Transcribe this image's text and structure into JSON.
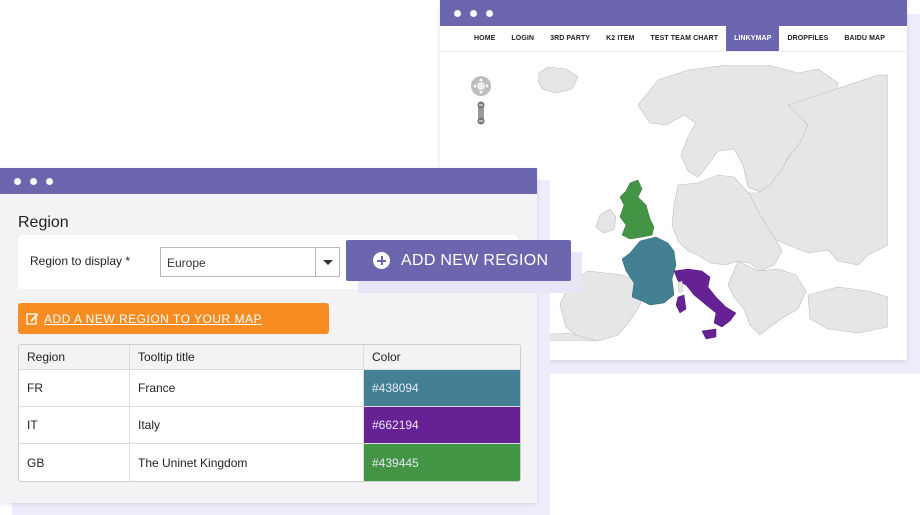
{
  "map_window": {
    "nav": [
      "HOME",
      "LOGIN",
      "3RD PARTY",
      "K2 ITEM",
      "TEST TEAM CHART",
      "LINKYMAP",
      "DROPFILES",
      "BAIDU MAP"
    ],
    "active_nav": "LINKYMAP",
    "colors": {
      "france": "#438094",
      "italy": "#662194",
      "gb": "#439445",
      "land": "#e6e6e6"
    },
    "icons": [
      "pan-control-icon",
      "zoom-slider-icon"
    ]
  },
  "admin": {
    "heading": "Region",
    "region_label": "Region to display *",
    "region_value": "Europe",
    "add_link_label": "ADD A NEW REGION TO YOUR MAP",
    "table": {
      "headers": [
        "Region",
        "Tooltip title",
        "Color"
      ],
      "rows": [
        {
          "region": "FR",
          "title": "France",
          "color": "#438094"
        },
        {
          "region": "IT",
          "title": "Italy",
          "color": "#662194"
        },
        {
          "region": "GB",
          "title": "The Uninet Kingdom",
          "color": "#439445"
        }
      ]
    }
  },
  "add_region_button": "ADD NEW REGION"
}
